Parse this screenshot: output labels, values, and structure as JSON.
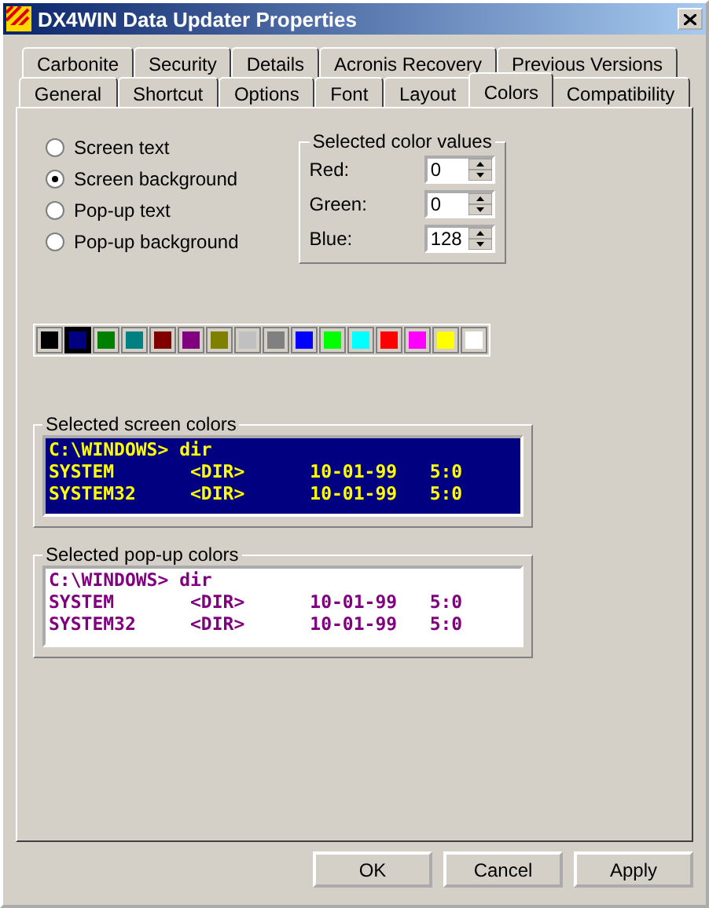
{
  "window": {
    "title": "DX4WIN Data Updater Properties"
  },
  "tabs_back": [
    {
      "label": "Carbonite",
      "selected": false
    },
    {
      "label": "Security",
      "selected": false
    },
    {
      "label": "Details",
      "selected": false
    },
    {
      "label": "Acronis Recovery",
      "selected": false
    },
    {
      "label": "Previous Versions",
      "selected": false
    }
  ],
  "tabs_front": [
    {
      "label": "General",
      "selected": false
    },
    {
      "label": "Shortcut",
      "selected": false
    },
    {
      "label": "Options",
      "selected": false
    },
    {
      "label": "Font",
      "selected": false
    },
    {
      "label": "Layout",
      "selected": false
    },
    {
      "label": "Colors",
      "selected": true
    },
    {
      "label": "Compatibility",
      "selected": false
    }
  ],
  "color_targets": [
    {
      "label": "Screen text",
      "selected": false
    },
    {
      "label": "Screen background",
      "selected": true
    },
    {
      "label": "Pop-up text",
      "selected": false
    },
    {
      "label": "Pop-up background",
      "selected": false
    }
  ],
  "color_values": {
    "title": "Selected color values",
    "fields": [
      {
        "label": "Red:",
        "value": "0"
      },
      {
        "label": "Green:",
        "value": "0"
      },
      {
        "label": "Blue:",
        "value": "128"
      }
    ]
  },
  "palette": [
    {
      "color": "#000000",
      "selected": false
    },
    {
      "color": "#000080",
      "selected": true
    },
    {
      "color": "#008000",
      "selected": false
    },
    {
      "color": "#008080",
      "selected": false
    },
    {
      "color": "#800000",
      "selected": false
    },
    {
      "color": "#800080",
      "selected": false
    },
    {
      "color": "#808000",
      "selected": false
    },
    {
      "color": "#c0c0c0",
      "selected": false
    },
    {
      "color": "#808080",
      "selected": false
    },
    {
      "color": "#0000ff",
      "selected": false
    },
    {
      "color": "#00ff00",
      "selected": false
    },
    {
      "color": "#00ffff",
      "selected": false
    },
    {
      "color": "#ff0000",
      "selected": false
    },
    {
      "color": "#ff00ff",
      "selected": false
    },
    {
      "color": "#ffff00",
      "selected": false
    },
    {
      "color": "#ffffff",
      "selected": false
    }
  ],
  "previews": [
    {
      "title": "Selected screen colors",
      "text": {
        "color": "#ffff00"
      },
      "screen": {
        "color": "#000080"
      },
      "lines": [
        "C:\\WINDOWS> dir",
        "SYSTEM       <DIR>      10-01-99   5:0",
        "SYSTEM32     <DIR>      10-01-99   5:0"
      ]
    },
    {
      "title": "Selected pop-up colors",
      "text": {
        "color": "#800080"
      },
      "screen": {
        "color": "#ffffff"
      },
      "lines": [
        "C:\\WINDOWS> dir",
        "SYSTEM       <DIR>      10-01-99   5:0",
        "SYSTEM32     <DIR>      10-01-99   5:0"
      ]
    }
  ],
  "buttons": [
    "OK",
    "Cancel",
    "Apply"
  ]
}
